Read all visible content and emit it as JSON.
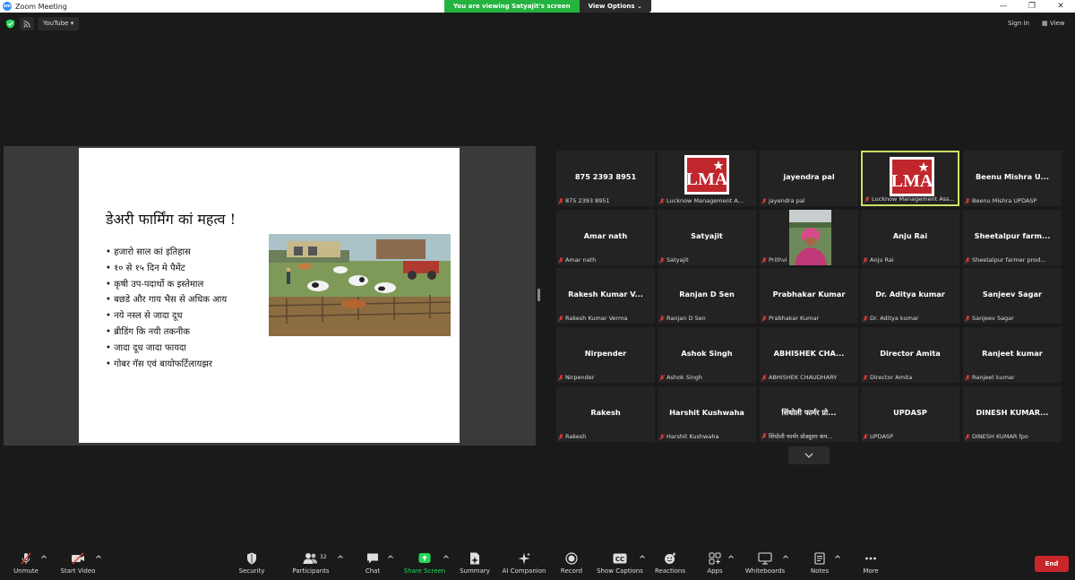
{
  "window": {
    "title": "Zoom Meeting",
    "banner_message": "You are viewing Satyajit's screen",
    "banner_options": "View Options"
  },
  "topbar": {
    "stream_label": "YouTube",
    "sign_in": "Sign in",
    "view": "View"
  },
  "slide": {
    "title": "डेअरी फार्मिंग कां महत्व  !",
    "bullets": [
      "• हजारो साल कां  इतिहास",
      "• १० से १५ दिन मे पैमेंट",
      "• कृषी उप-पदार्थो क इस्तेमाल",
      "• बछडे और गाय भैस से अधिक आय",
      "• नये नस्ल से जादा दूध",
      "• ब्रीडिंग कि नयी तकनीक",
      "• जादा दूध जादा फायदा",
      "• गोबर गॅस एवं बायोफर्टिलायझर"
    ]
  },
  "participants_grid": [
    {
      "big": "875 2393 8951",
      "small": "875 2393 8951"
    },
    {
      "big": "",
      "small": "Lucknow Management A...",
      "logo": "LMA"
    },
    {
      "big": "jayendra pal",
      "small": "jayendra pal"
    },
    {
      "big": "",
      "small": "Lucknow Management Ass...",
      "logo": "LMA",
      "active": true
    },
    {
      "big": "Beenu  Mishra  U...",
      "small": "Beenu Mishra UPDASP"
    },
    {
      "big": "Amar nath",
      "small": "Amar nath"
    },
    {
      "big": "Satyajit",
      "small": "Satyajit"
    },
    {
      "big": "",
      "small": "Prithvi",
      "photo": true
    },
    {
      "big": "Anju Rai",
      "small": "Anju Rai"
    },
    {
      "big": "Sheetalpur  farm...",
      "small": "Sheetalpur farmer prod..."
    },
    {
      "big": "Rakesh  Kumar  V...",
      "small": "Rakesh Kumar Verma"
    },
    {
      "big": "Ranjan D Sen",
      "small": "Ranjan D Sen"
    },
    {
      "big": "Prabhakar Kumar",
      "small": "Prabhakar Kumar"
    },
    {
      "big": "Dr. Aditya kumar",
      "small": "Dr. Aditya kumar"
    },
    {
      "big": "Sanjeev Sagar",
      "small": "Sanjeev Sagar"
    },
    {
      "big": "Nirpender",
      "small": "Nirpender"
    },
    {
      "big": "Ashok Singh",
      "small": "Ashok Singh"
    },
    {
      "big": "ABHISHEK  CHA...",
      "small": "ABHISHEK CHAUDHARY"
    },
    {
      "big": "Director Amita",
      "small": "Director Amita"
    },
    {
      "big": "Ranjeet kumar",
      "small": "Ranjeet kumar"
    },
    {
      "big": "Rakesh",
      "small": "Rakesh"
    },
    {
      "big": "Harshit Kushwaha",
      "small": "Harshit Kushwaha"
    },
    {
      "big": "सिंधोली फार्मर प्रो...",
      "small": "सिंधोली फार्मर प्रोड्यूसर कंप..."
    },
    {
      "big": "UPDASP",
      "small": "UPDASP"
    },
    {
      "big": "DINESH  KUMAR...",
      "small": "DINESH KUMAR fpo"
    }
  ],
  "toolbar": {
    "unmute": "Unmute",
    "start_video": "Start Video",
    "security": "Security",
    "participants": "Participants",
    "participants_count": "32",
    "chat": "Chat",
    "share_screen": "Share Screen",
    "summary": "Summary",
    "ai_companion": "AI Companion",
    "record": "Record",
    "show_captions": "Show Captions",
    "reactions": "Reactions",
    "apps": "Apps",
    "whiteboards": "Whiteboards",
    "notes": "Notes",
    "more": "More",
    "end": "End"
  },
  "colors": {
    "banner_green": "#25b33f",
    "share_green": "#23d959",
    "end_red": "#c8262b",
    "active_speaker": "#c9e265"
  }
}
